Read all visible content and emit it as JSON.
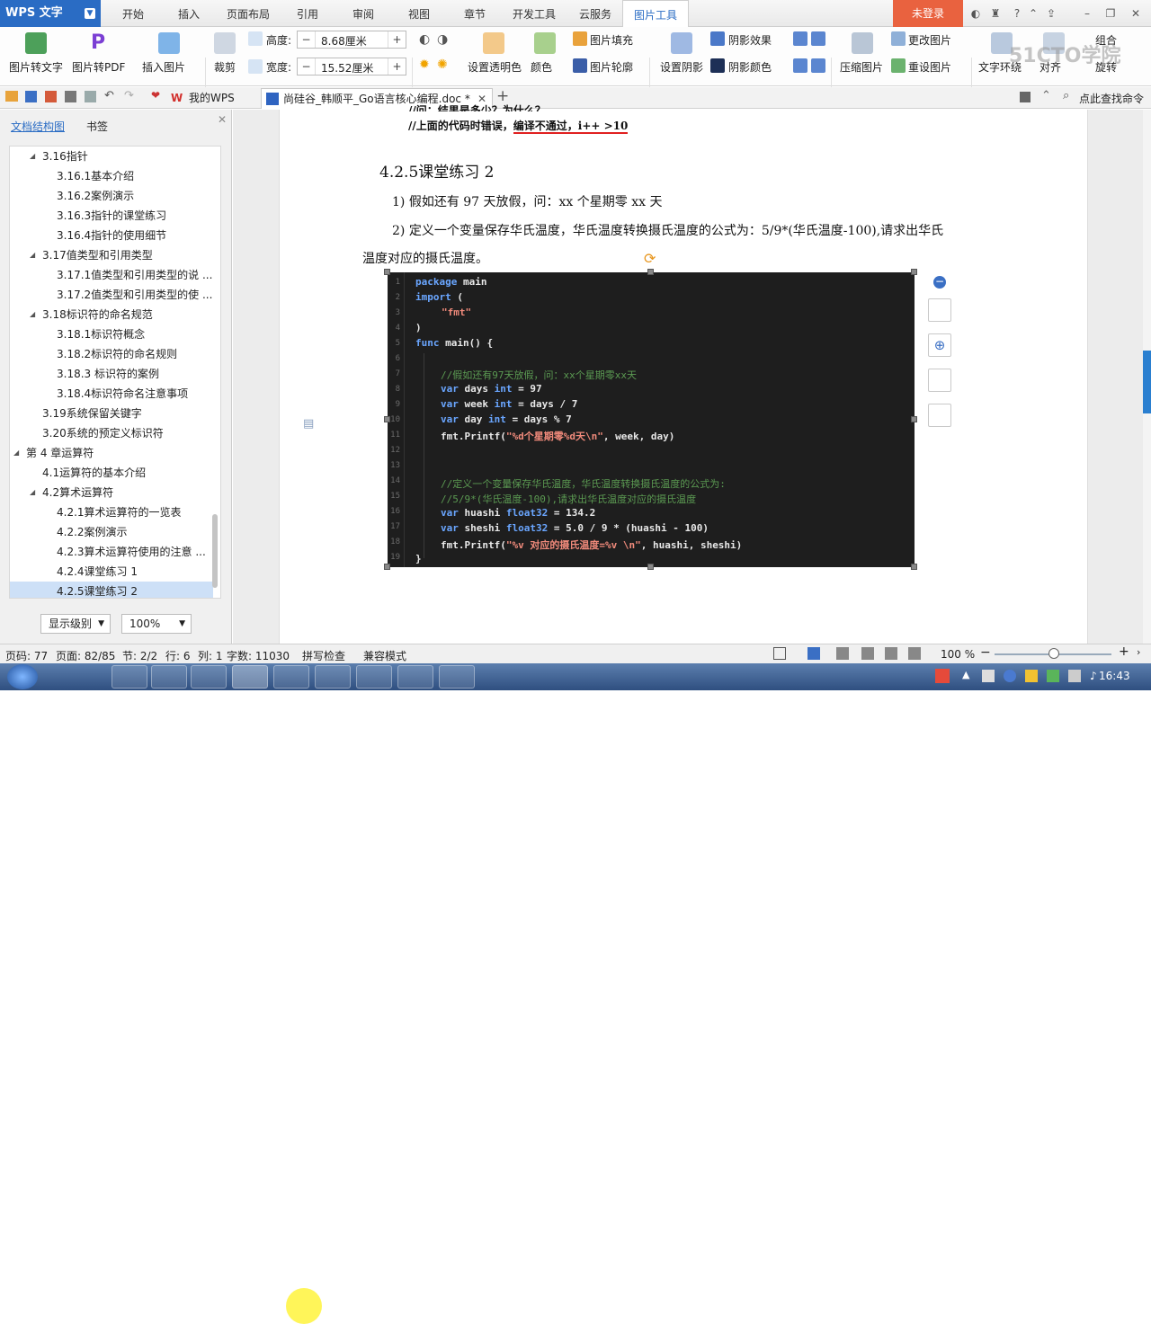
{
  "app": {
    "name": "WPS 文字",
    "login": "未登录"
  },
  "menu_tabs": [
    "开始",
    "插入",
    "页面布局",
    "引用",
    "审阅",
    "视图",
    "章节",
    "开发工具",
    "云服务",
    "图片工具"
  ],
  "active_tab": "图片工具",
  "ribbon": {
    "pic_to_text": "图片转文字",
    "pic_to_pdf": "图片转PDF",
    "insert_pic": "插入图片",
    "crop": "裁剪",
    "height_label": "高度:",
    "height_value": "8.68厘米",
    "width_label": "宽度:",
    "width_value": "15.52厘米",
    "set_transparent": "设置透明色",
    "color": "颜色",
    "pic_fill": "图片填充",
    "pic_outline": "图片轮廓",
    "set_shadow": "设置阴影",
    "shadow_effect": "阴影效果",
    "shadow_color": "阴影颜色",
    "compress": "压缩图片",
    "change_pic": "更改图片",
    "reset_pic": "重设图片",
    "text_wrap": "文字环绕",
    "align": "对齐",
    "group": "组合",
    "rotate": "旋转",
    "minus": "−",
    "plus": "+"
  },
  "quickbar": {
    "tab_mywps": "我的WPS",
    "tab_doc": "尚硅谷_韩顺平_Go语言核心编程.doc *",
    "add": "+",
    "search": "点此查找命令"
  },
  "sidebar": {
    "tab_outline": "文档结构图",
    "tab_bookmark": "书签",
    "items": [
      {
        "label": "3.16指针",
        "level": 1,
        "expander": "◢"
      },
      {
        "label": "3.16.1基本介绍",
        "level": 2,
        "expander": ""
      },
      {
        "label": "3.16.2案例演示",
        "level": 2,
        "expander": ""
      },
      {
        "label": "3.16.3指针的课堂练习",
        "level": 2,
        "expander": ""
      },
      {
        "label": "3.16.4指针的使用细节",
        "level": 2,
        "expander": ""
      },
      {
        "label": "3.17值类型和引用类型",
        "level": 1,
        "expander": "◢"
      },
      {
        "label": "3.17.1值类型和引用类型的说 ...",
        "level": 2,
        "expander": ""
      },
      {
        "label": "3.17.2值类型和引用类型的使 ...",
        "level": 2,
        "expander": ""
      },
      {
        "label": "3.18标识符的命名规范",
        "level": 1,
        "expander": "◢"
      },
      {
        "label": "3.18.1标识符概念",
        "level": 2,
        "expander": ""
      },
      {
        "label": "3.18.2标识符的命名规则",
        "level": 2,
        "expander": ""
      },
      {
        "label": "3.18.3  标识符的案例",
        "level": 2,
        "expander": ""
      },
      {
        "label": "3.18.4标识符命名注意事项",
        "level": 2,
        "expander": ""
      },
      {
        "label": "3.19系统保留关键字",
        "level": 1,
        "expander": ""
      },
      {
        "label": "3.20系统的预定义标识符",
        "level": 1,
        "expander": ""
      },
      {
        "label": "第 4 章运算符",
        "level": 0,
        "expander": "◢"
      },
      {
        "label": "4.1运算符的基本介绍",
        "level": 1,
        "expander": ""
      },
      {
        "label": "4.2算术运算符",
        "level": 1,
        "expander": "◢"
      },
      {
        "label": "4.2.1算术运算符的一览表",
        "level": 2,
        "expander": ""
      },
      {
        "label": "4.2.2案例演示",
        "level": 2,
        "expander": ""
      },
      {
        "label": "4.2.3算术运算符使用的注意 ...",
        "level": 2,
        "expander": ""
      },
      {
        "label": "4.2.4课堂练习 1",
        "level": 2,
        "expander": ""
      },
      {
        "label": "4.2.5课堂练习 2",
        "level": 2,
        "expander": "",
        "selected": true
      }
    ],
    "show_level": "显示级别",
    "zoom": "100%"
  },
  "document": {
    "line_top1": "//问：结果是多少？为什么？",
    "line_top2a": "//上面的代码时错误，",
    "line_top2b": "编译不通过，i++ >10",
    "heading": "4.2.5课堂练习 2",
    "p1": "1)  假如还有 97 天放假，问：xx 个星期零 xx 天",
    "p2a": "2)  定义一个变量保存华氏温度，华氏温度转换摄氏温度的公式为：5/9*(华氏温度-100),请求出华氏",
    "p2b": "温度对应的摄氏温度。"
  },
  "code": {
    "line_numbers": [
      "1",
      "2",
      "3",
      "4",
      "5",
      "6",
      "7",
      "8",
      "9",
      "10",
      "11",
      "12",
      "13",
      "14",
      "15",
      "16",
      "17",
      "18",
      "19"
    ],
    "l1_kw": "package",
    "l1_rest": " main",
    "l2_kw": "import",
    "l2_rest": " (",
    "l3": "\"fmt\"",
    "l4": ")",
    "l5_kw": "func",
    "l5_rest": " main() {",
    "l7": "//假如还有97天放假，问：xx个星期零xx天",
    "l8_kw": "var",
    "l8_a": " days ",
    "l8_t": "int",
    "l8_b": " = 97",
    "l9_kw": "var",
    "l9_a": " week ",
    "l9_t": "int",
    "l9_b": " = days / 7",
    "l10_kw": "var",
    "l10_a": " day ",
    "l10_t": "int",
    "l10_b": " = days % 7",
    "l11_a": "fmt.Printf(",
    "l11_s": "\"%d个星期零%d天\\n\"",
    "l11_b": ", week, day)",
    "l14": "//定义一个变量保存华氏温度，华氏温度转换摄氏温度的公式为:",
    "l15": "//5/9*(华氏温度-100),请求出华氏温度对应的摄氏温度",
    "l16_kw": "var",
    "l16_a": " huashi ",
    "l16_t": "float32",
    "l16_b": " = 134.2",
    "l17_kw": "var",
    "l17_a": " sheshi ",
    "l17_t": "float32",
    "l17_b": " = 5.0 / 9 * (huashi - 100)",
    "l18_a": "fmt.Printf(",
    "l18_s": "\"%v 对应的摄氏温度=%v \\n\"",
    "l18_b": ", huashi, sheshi)",
    "l19": "}"
  },
  "status": {
    "page_code": "页码: 77",
    "page": "页面: 82/85",
    "section": "节: 2/2",
    "row": "行: 6",
    "col": "列: 1",
    "words": "字数: 11030",
    "spell": "拼写检查",
    "compat": "兼容模式",
    "zoom": "100 %"
  },
  "taskbar": {
    "time": "16:43"
  },
  "watermark": "51CTO学院"
}
